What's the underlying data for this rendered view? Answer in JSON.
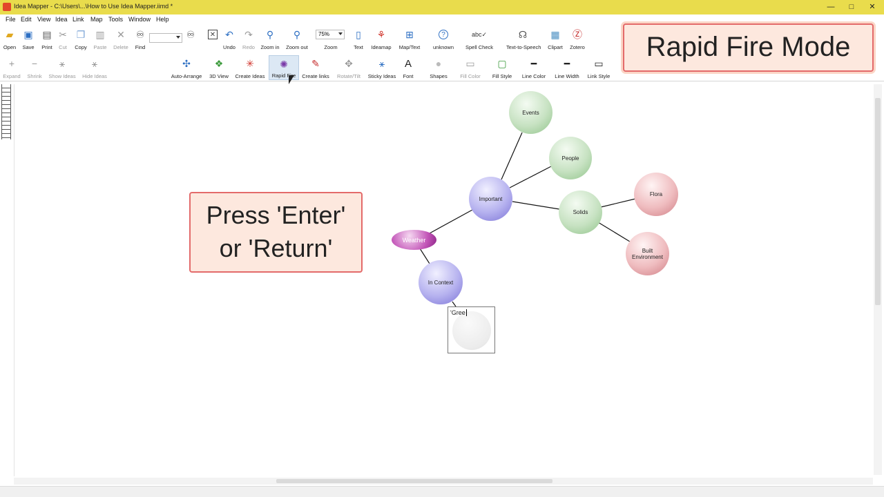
{
  "window": {
    "title": "Idea Mapper - C:\\Users\\...\\How to Use Idea Mapper.iimd *",
    "controls": {
      "minimize": "—",
      "maximize": "□",
      "close": "✕"
    }
  },
  "menu": [
    "File",
    "Edit",
    "View",
    "Idea",
    "Link",
    "Map",
    "Tools",
    "Window",
    "Help"
  ],
  "toolbar1": {
    "open": "Open",
    "save": "Save",
    "print": "Print",
    "cut": "Cut",
    "copy": "Copy",
    "paste": "Paste",
    "delete": "Delete",
    "find": "Find",
    "undo": "Undo",
    "redo": "Redo",
    "zoom_in": "Zoom in",
    "zoom_out": "Zoom out",
    "zoom": "Zoom",
    "zoom_value": "75%",
    "text": "Text",
    "ideamap": "Ideamap",
    "map_text": "Map/Text",
    "unknown": "unknown",
    "spell_check": "Spell Check",
    "text_to_speech": "Text-to-Speech",
    "clipart": "Clipart",
    "zotero": "Zotero"
  },
  "toolbar2": {
    "expand": "Expand",
    "shrink": "Shrink",
    "show_ideas": "Show Ideas",
    "hide_ideas": "Hide Ideas",
    "auto_arrange": "Auto-Arrange",
    "view_3d": "3D View",
    "create_ideas": "Create Ideas",
    "rapid_fire": "Rapid Fire",
    "create_links": "Create links",
    "rotate_tilt": "Rotate/Tilt",
    "sticky_ideas": "Sticky Ideas",
    "font": "Font",
    "shapes": "Shapes",
    "fill_color": "Fill Color",
    "fill_style": "Fill Style",
    "line_color": "Line Color",
    "line_width": "Line Width",
    "link_style": "Link Style"
  },
  "overlays": {
    "mode_title": "Rapid Fire Mode",
    "callout_line1": "Press 'Enter'",
    "callout_line2": "or 'Return'"
  },
  "map": {
    "nodes": {
      "events": "Events",
      "people": "People",
      "important": "Important",
      "solids": "Solids",
      "flora": "Flora",
      "built_line1": "Built",
      "built_line2": "Environment",
      "weather": "Weather",
      "in_context": "In Context"
    },
    "new_idea_text": "'Gree"
  },
  "colors": {
    "titlebar": "#e9dc4c",
    "overlay_border": "#e36a6a",
    "overlay_fill": "#fde8de"
  }
}
